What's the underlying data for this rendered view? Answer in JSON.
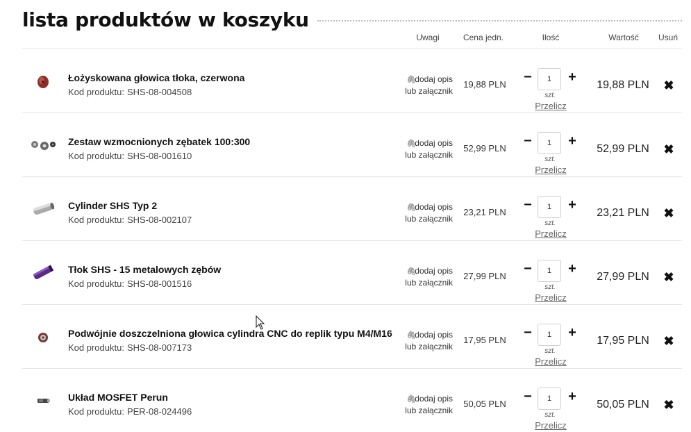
{
  "page": {
    "title": "lista produktów w koszyku"
  },
  "table": {
    "headers": {
      "notes": "Uwagi",
      "unit_price": "Cena jedn.",
      "quantity": "Ilość",
      "value": "Wartość",
      "remove": "Usuń"
    },
    "code_label": "Kod produktu:",
    "note_line1": "dodaj opis",
    "note_line2": "lub załącznik",
    "qty_unit": "szt.",
    "recalc_label": "Przelicz",
    "minus_symbol": "−",
    "plus_symbol": "+",
    "remove_symbol": "✖",
    "paperclip_icon": "paperclip-icon",
    "items": [
      {
        "name": "Łożyskowana głowica tłoka, czerwona",
        "code": "SHS-08-004508",
        "unit_price": "19,88 PLN",
        "qty": "1",
        "value": "19,88 PLN"
      },
      {
        "name": "Zestaw wzmocnionych zębatek 100:300",
        "code": "SHS-08-001610",
        "unit_price": "52,99 PLN",
        "qty": "1",
        "value": "52,99 PLN"
      },
      {
        "name": "Cylinder SHS Typ 2",
        "code": "SHS-08-002107",
        "unit_price": "23,21 PLN",
        "qty": "1",
        "value": "23,21 PLN"
      },
      {
        "name": "Tłok SHS - 15 metalowych zębów",
        "code": "SHS-08-001516",
        "unit_price": "27,99 PLN",
        "qty": "1",
        "value": "27,99 PLN"
      },
      {
        "name": "Podwójnie doszczelniona głowica cylindra CNC do replik typu M4/M16",
        "code": "SHS-08-007173",
        "unit_price": "17,95 PLN",
        "qty": "1",
        "value": "17,95 PLN"
      },
      {
        "name": "Układ MOSFET Perun",
        "code": "PER-08-024496",
        "unit_price": "50,05 PLN",
        "qty": "1",
        "value": "50,05 PLN"
      }
    ]
  }
}
